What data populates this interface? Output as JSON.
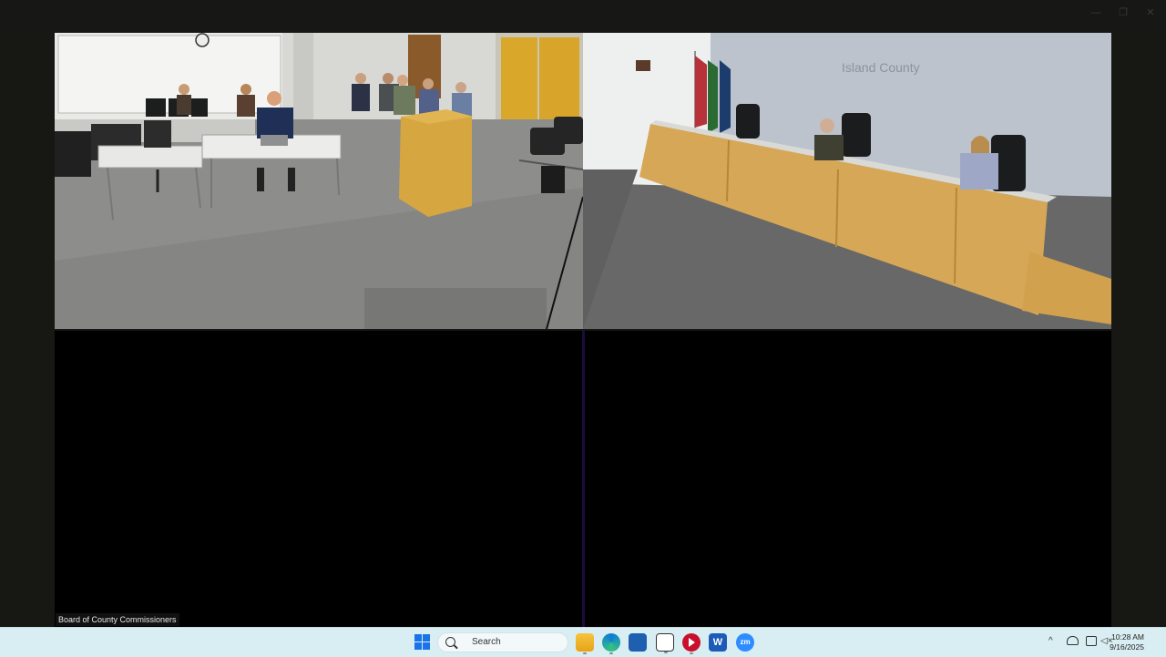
{
  "meeting": {
    "participant_label": "Board of County Commissioners",
    "room_sign": "Island County"
  },
  "taskbar": {
    "search_label": "Search",
    "apps": [
      "file-explorer",
      "edge",
      "store",
      "vlc",
      "stop-record",
      "word",
      "zoom"
    ],
    "zoom_label": "zm",
    "word_label": "W",
    "time": "10:28 AM",
    "date": "9/16/2025"
  },
  "colors": {
    "active_speaker_border": "#4b1fa6",
    "taskbar_bg": "#d9eef2"
  }
}
